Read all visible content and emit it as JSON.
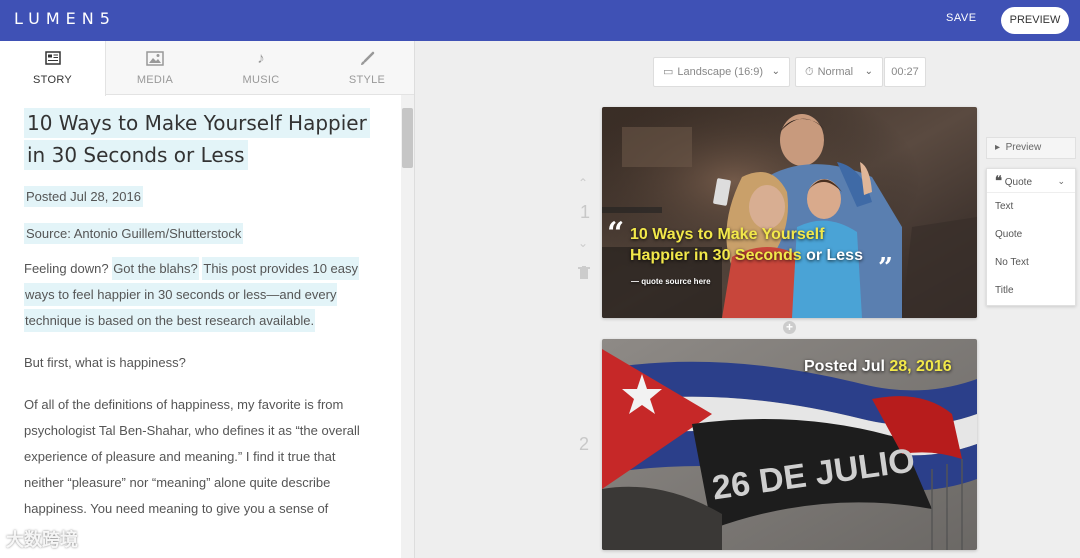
{
  "app": {
    "logo": "LUMEN5"
  },
  "header": {
    "save_label": "SAVE",
    "preview_label": "PREVIEW"
  },
  "tabs": [
    {
      "label": "STORY",
      "icon": "story-icon"
    },
    {
      "label": "MEDIA",
      "icon": "image-icon"
    },
    {
      "label": "MUSIC",
      "icon": "music-note-icon"
    },
    {
      "label": "STYLE",
      "icon": "brush-icon"
    }
  ],
  "story": {
    "title_line1": "10 Ways to Make Yourself Happier",
    "title_line2": "in 30 Seconds or Less",
    "posted": "Posted Jul 28, 2016",
    "source": "Source: Antonio Guillem/Shutterstock",
    "p1_a": "Feeling down?",
    "p1_b": "Got the blahs?",
    "p1_c": "This post provides 10 easy",
    "p1_d": "ways to feel happier in 30 seconds or less—and every",
    "p1_e": "technique is based on the best research available.",
    "p2": "But first, what is happiness?",
    "p3_a": "Of all of the definitions of happiness, my favorite is from",
    "p3_b": "psychologist Tal Ben-Shahar, who defines it as “the overall",
    "p3_c": "experience of pleasure and meaning.” I find it true that",
    "p3_d": "neither “pleasure” nor “meaning” alone quite describe",
    "p3_e": "happiness. You need meaning to give you a sense of"
  },
  "controls": {
    "orientation": "Landscape (16:9)",
    "speed": "Normal",
    "duration": "00:27"
  },
  "slides": [
    {
      "number": "1",
      "quote_yellow_1": "10 Ways to Make Yourself",
      "quote_yellow_2": "Happier in 30 Seconds",
      "quote_white_2": "or Less",
      "quote_open": "“",
      "quote_close": "”",
      "source_text": "— quote source here"
    },
    {
      "number": "2",
      "posted_white": "Posted Jul",
      "posted_yellow": "28, 2016",
      "flag_text": "26 DE JULIO"
    }
  ],
  "side_panel": {
    "preview_label": "Preview",
    "layout_selected": "Quote",
    "layout_options": [
      "Text",
      "Quote",
      "No Text",
      "Title"
    ]
  },
  "watermark": "大数跨境"
}
